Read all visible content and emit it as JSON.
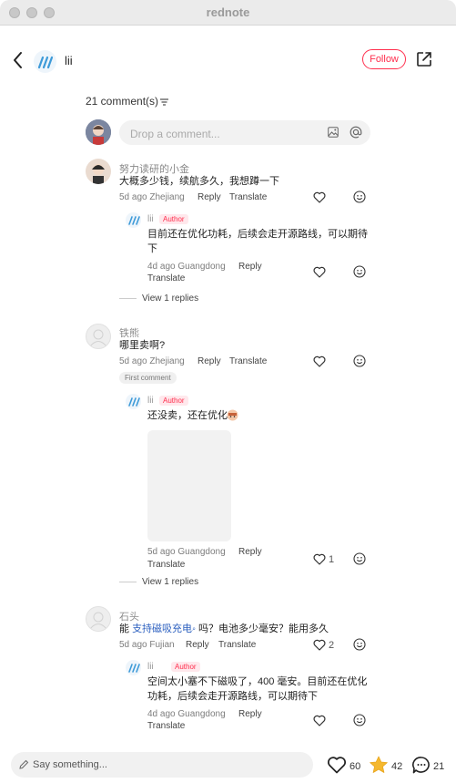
{
  "window": {
    "title": "rednote"
  },
  "header": {
    "username": "lii",
    "follow_label": "Follow"
  },
  "comments_count": "21 comment(s)",
  "input": {
    "placeholder": "Drop a comment..."
  },
  "labels": {
    "reply": "Reply",
    "translate": "Translate",
    "author": "Author",
    "first_comment": "First comment",
    "view_replies": "View 1 replies"
  },
  "c1": {
    "name": "努力读研的小金",
    "text": "大概多少钱，续航多久，我想蹲一下",
    "meta": "5d ago Zhejiang"
  },
  "r1": {
    "name": "lii",
    "text1": "目前还在优化功耗，后续会走开源路线，可以期待",
    "text2": "下",
    "meta": "4d ago Guangdong"
  },
  "c2": {
    "name": "铁熊",
    "text": "哪里卖啊?",
    "meta": "5d ago Zhejiang"
  },
  "r2": {
    "name": "lii",
    "text": "还没卖，还在优化",
    "meta": "5d ago Guangdong",
    "likes": "1"
  },
  "c3": {
    "name": "石头",
    "text_pre": "能 ",
    "text_tag": "支持磁吸充电",
    "text_post": " 吗？电池多少毫安？能用多久",
    "meta": "5d ago Fujian",
    "likes": "2"
  },
  "r3": {
    "name": "lii",
    "text1": "空间太小塞不下磁吸了，400 毫安。目前还在优化",
    "text2": "功耗，后续会走开源路线，可以期待下",
    "meta": "4d ago Guangdong"
  },
  "bottom": {
    "placeholder": "Say something...",
    "likes": "60",
    "stars": "42",
    "comments": "21"
  },
  "colors": {
    "accent": "#ff2e4d",
    "star": "#f5b82e",
    "link": "#2b5fbf"
  },
  "icons": [
    "back-icon",
    "share-icon",
    "sort-icon",
    "image-icon",
    "at-icon",
    "heart-icon",
    "face-icon",
    "star-icon",
    "comment-icon",
    "pencil-icon"
  ]
}
